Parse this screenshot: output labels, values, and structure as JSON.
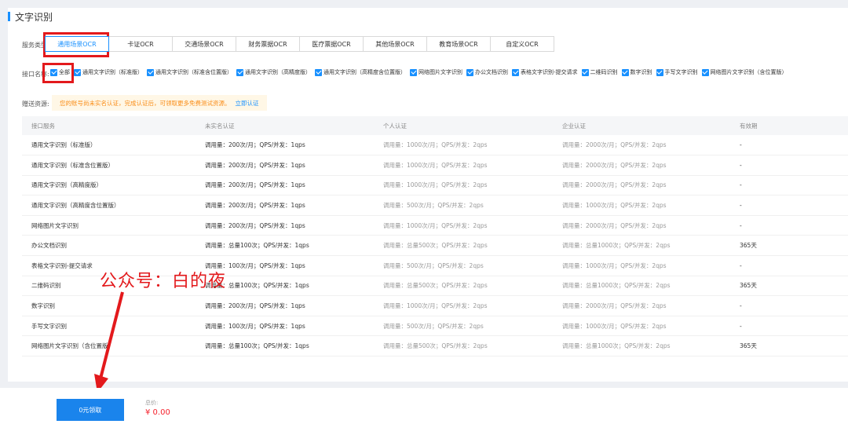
{
  "section": {
    "title": "文字识别"
  },
  "service_type": {
    "label": "服务类型:",
    "tabs": [
      "通用场景OCR",
      "卡证OCR",
      "交通场景OCR",
      "财务票据OCR",
      "医疗票据OCR",
      "其他场景OCR",
      "教育场景OCR",
      "自定义OCR"
    ],
    "active": "通用场景OCR"
  },
  "interfaces": {
    "label": "接口名称:",
    "options": [
      "全部",
      "通用文字识别（标准版）",
      "通用文字识别（标准含位置版）",
      "通用文字识别（高精度版）",
      "通用文字识别（高精度含位置版）",
      "网络图片文字识别",
      "办公文档识别",
      "表格文字识别-提交请求",
      "二维码识别",
      "数字识别",
      "手写文字识别",
      "网络图片文字识别（含位置版）"
    ]
  },
  "gift": {
    "label": "赠送资源:",
    "notice": "您的账号尚未实名认证，完成认证后，可领取更多免费测试资源。",
    "link": "立即认证"
  },
  "table": {
    "headers": [
      "接口服务",
      "未实名认证",
      "个人认证",
      "企业认证",
      "有效期"
    ],
    "rows": [
      [
        "通用文字识别（标准版）",
        "调用量：200次/月；QPS/并发：1qps",
        "调用量：1000次/月；QPS/并发：2qps",
        "调用量：2000次/月；QPS/并发：2qps",
        "-"
      ],
      [
        "通用文字识别（标准含位置版）",
        "调用量：200次/月；QPS/并发：1qps",
        "调用量：1000次/月；QPS/并发：2qps",
        "调用量：2000次/月；QPS/并发：2qps",
        "-"
      ],
      [
        "通用文字识别（高精度版）",
        "调用量：200次/月；QPS/并发：1qps",
        "调用量：1000次/月；QPS/并发：2qps",
        "调用量：2000次/月；QPS/并发：2qps",
        "-"
      ],
      [
        "通用文字识别（高精度含位置版）",
        "调用量：200次/月；QPS/并发：1qps",
        "调用量：500次/月；QPS/并发：2qps",
        "调用量：1000次/月；QPS/并发：2qps",
        "-"
      ],
      [
        "网络图片文字识别",
        "调用量：200次/月；QPS/并发：1qps",
        "调用量：1000次/月；QPS/并发：2qps",
        "调用量：2000次/月；QPS/并发：2qps",
        "-"
      ],
      [
        "办公文档识别",
        "调用量：总量100次；QPS/并发：1qps",
        "调用量：总量500次；QPS/并发：2qps",
        "调用量：总量1000次；QPS/并发：2qps",
        "365天"
      ],
      [
        "表格文字识别-提交请求",
        "调用量：100次/月；QPS/并发：1qps",
        "调用量：500次/月；QPS/并发：2qps",
        "调用量：1000次/月；QPS/并发：2qps",
        "-"
      ],
      [
        "二维码识别",
        "调用量：总量100次；QPS/并发：1qps",
        "调用量：总量500次；QPS/并发：2qps",
        "调用量：总量1000次；QPS/并发：2qps",
        "365天"
      ],
      [
        "数字识别",
        "调用量：200次/月；QPS/并发：1qps",
        "调用量：1000次/月；QPS/并发：2qps",
        "调用量：2000次/月；QPS/并发：2qps",
        "-"
      ],
      [
        "手写文字识别",
        "调用量：100次/月；QPS/并发：1qps",
        "调用量：500次/月；QPS/并发：2qps",
        "调用量：1000次/月；QPS/并发：2qps",
        "-"
      ],
      [
        "网络图片文字识别（含位置版）",
        "调用量：总量100次；QPS/并发：1qps",
        "调用量：总量500次；QPS/并发：2qps",
        "调用量：总量1000次；QPS/并发：2qps",
        "365天"
      ]
    ]
  },
  "watermark": "公众号：白的夜",
  "footer": {
    "claim_button": "0元领取",
    "total_label": "总价:",
    "total_value": "¥ 0.00"
  },
  "colors": {
    "accent": "#1890ff",
    "highlight": "#e3191c",
    "notice_bg": "#fff7e6",
    "notice_text": "#fa8c16",
    "price": "#f5222d"
  }
}
